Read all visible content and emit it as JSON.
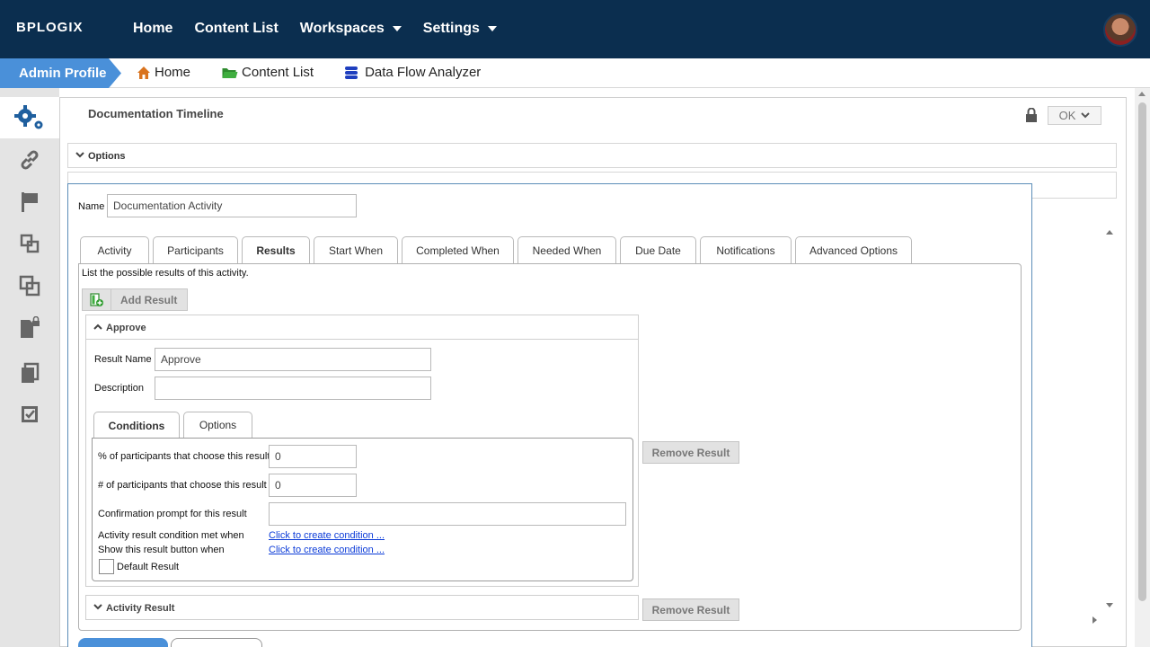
{
  "brand": {
    "logo_text": "BPLOGIX"
  },
  "topnav": {
    "home": "Home",
    "content_list": "Content List",
    "workspaces": "Workspaces",
    "settings": "Settings"
  },
  "crumbbar": {
    "profile": "Admin Profile",
    "home": "Home",
    "content_list": "Content List",
    "data_flow": "Data Flow Analyzer"
  },
  "rail_icons": [
    "gears-icon",
    "link-icon",
    "flag-icon",
    "nested-squares-icon",
    "overlap-squares-icon",
    "locked-document-icon",
    "copy-icon",
    "checkbox-icon"
  ],
  "main": {
    "title": "Documentation Timeline",
    "ok_label": "OK",
    "options_label": "Options"
  },
  "dialog": {
    "name_label": "Name",
    "name_value": "Documentation Activity",
    "tabs": [
      "Activity",
      "Participants",
      "Results",
      "Start When",
      "Completed When",
      "Needed When",
      "Due Date",
      "Notifications",
      "Advanced Options"
    ],
    "active_tab": "Results",
    "results_hint": "List the possible results of this activity.",
    "add_result_label": "Add Result",
    "approve": {
      "header": "Approve",
      "result_name_label": "Result Name",
      "result_name_value": "Approve",
      "description_label": "Description",
      "description_value": "",
      "inner_tabs": [
        "Conditions",
        "Options"
      ],
      "pct_label": "% of participants that choose this result",
      "pct_value": "0",
      "count_label": "# of participants that choose this result",
      "count_value": "0",
      "confirm_label": "Confirmation prompt for this result",
      "confirm_value": "",
      "cond_met_label": "Activity result condition met when",
      "cond_met_link": "Click to create condition ...",
      "show_btn_label": "Show this result button when",
      "show_btn_link": "Click to create condition ...",
      "default_label": "Default Result"
    },
    "remove_result_label": "Remove Result",
    "activity_result_header": "Activity Result"
  },
  "colors": {
    "nav_bg": "#0b2e4f",
    "accent": "#4a90d9",
    "link": "#0b3bd8"
  }
}
